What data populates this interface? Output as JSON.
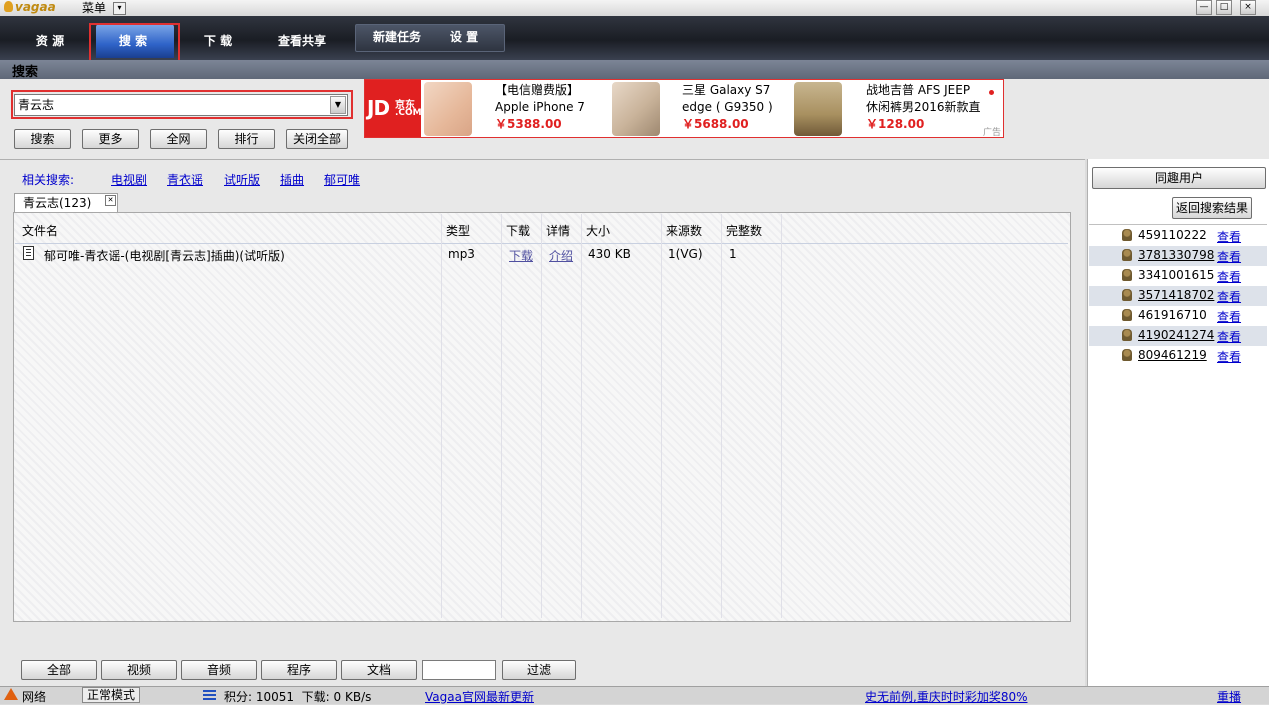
{
  "titlebar": {
    "logo": "vagaa",
    "menu_label": "菜单",
    "min": "—",
    "max": "□",
    "close": "×"
  },
  "nav": {
    "tabs": [
      "资 源",
      "搜 索",
      "下 载",
      "查看共享"
    ],
    "new_task": "新建任务",
    "settings": "设 置"
  },
  "section_title": "搜索",
  "search": {
    "value": "青云志",
    "buttons": [
      "搜索",
      "更多",
      "全网",
      "排行",
      "关闭全部"
    ]
  },
  "ad": {
    "logo_top": "JD",
    "logo_sub": "京东",
    "logo_com": ".COM",
    "items": [
      {
        "line1": "【电信赠费版】",
        "line2": "Apple iPhone 7",
        "price": "￥5388.00"
      },
      {
        "line1": "三星 Galaxy S7",
        "line2": "edge ( G9350 )",
        "price": "￥5688.00"
      },
      {
        "line1": "战地吉普 AFS JEEP",
        "line2": "休闲裤男2016新款直",
        "price": "￥128.00"
      }
    ],
    "badge": "广告"
  },
  "related": {
    "label": "相关搜索:",
    "links": [
      "电视剧",
      "青衣谣",
      "试听版",
      "插曲",
      "郁可唯"
    ]
  },
  "result_tab": {
    "label": "青云志(123)"
  },
  "table": {
    "columns": [
      "文件名",
      "类型",
      "下载",
      "详情",
      "大小",
      "来源数",
      "完整数"
    ],
    "rows": [
      {
        "name": "郁可唯-青衣谣-(电视剧[青云志]插曲)(试听版)",
        "type": "mp3",
        "download": "下载",
        "detail": "介绍",
        "size": "430 KB",
        "sources": "1(VG)",
        "complete": "1"
      }
    ]
  },
  "filters": {
    "buttons": [
      "全部",
      "视频",
      "音频",
      "程序",
      "文档"
    ],
    "filter_input": "",
    "filter_button": "过滤"
  },
  "right": {
    "title": "同趣用户",
    "back": "返回搜索结果",
    "view": "查看",
    "peers": [
      "459110222",
      "3781330798",
      "3341001615",
      "3571418702",
      "461916710",
      "4190241274",
      "809461219"
    ]
  },
  "status": {
    "network": "网络",
    "mode": "正常模式",
    "stats": "积分: 10051  下载: 0 KB/s",
    "update_link": "Vagaa官网最新更新",
    "promo_link": "史无前例,重庆时时彩加奖80%",
    "replay": "重播"
  }
}
